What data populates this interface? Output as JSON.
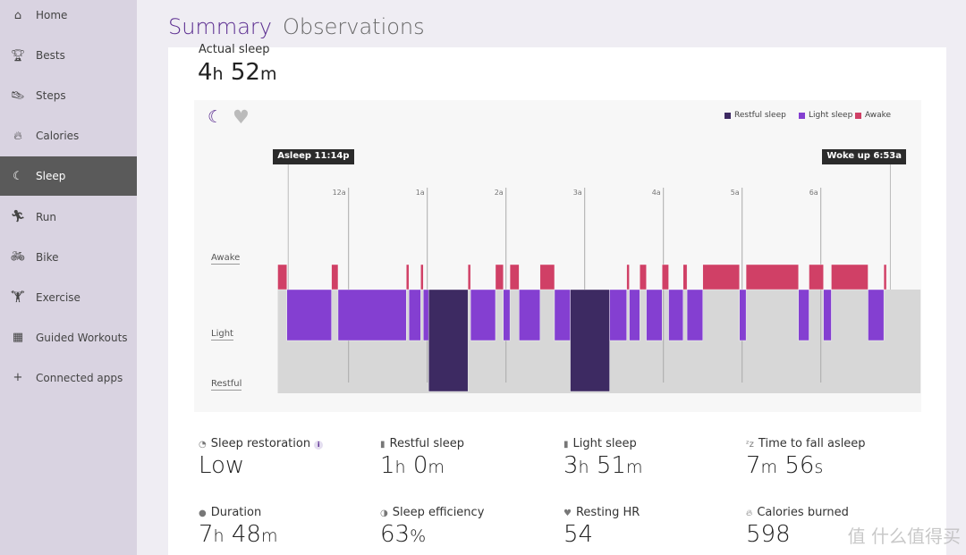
{
  "sidebar": {
    "items": [
      {
        "label": "Home",
        "icon": "home-icon",
        "glyph": "⌂"
      },
      {
        "label": "Bests",
        "icon": "trophy-icon",
        "glyph": "🏆︎"
      },
      {
        "label": "Steps",
        "icon": "shoe-icon",
        "glyph": "👟︎"
      },
      {
        "label": "Calories",
        "icon": "flame-icon",
        "glyph": "🔥︎"
      },
      {
        "label": "Sleep",
        "icon": "moon-icon",
        "glyph": "☾",
        "active": true
      },
      {
        "label": "Run",
        "icon": "runner-icon",
        "glyph": "🏃︎"
      },
      {
        "label": "Bike",
        "icon": "bike-icon",
        "glyph": "🚲︎"
      },
      {
        "label": "Exercise",
        "icon": "dumbbell-icon",
        "glyph": "🏋︎"
      },
      {
        "label": "Guided Workouts",
        "icon": "guided-workout-icon",
        "glyph": "▦"
      },
      {
        "label": "Connected apps",
        "icon": "plus-icon",
        "glyph": "+"
      }
    ]
  },
  "header": {
    "tab_summary": "Summary",
    "tab_observations": "Observations"
  },
  "actual_sleep": {
    "label": "Actual sleep",
    "hours": "4",
    "h": "h",
    "minutes": "52",
    "m": "m"
  },
  "chart_data": {
    "type": "timeline",
    "x_range": [
      "23:06",
      "07:16"
    ],
    "x_ticks": [
      "12a",
      "1a",
      "2a",
      "3a",
      "4a",
      "5a",
      "6a"
    ],
    "rows": [
      "Awake",
      "Light",
      "Restful"
    ],
    "markers": {
      "asleep": {
        "label": "Asleep 11:14p",
        "time": "23:14"
      },
      "woke": {
        "label": "Woke up 6:53a",
        "time": "06:53"
      }
    },
    "legend": [
      {
        "name": "Restful sleep",
        "color": "#3d2a62"
      },
      {
        "name": "Light sleep",
        "color": "#843fd1"
      },
      {
        "name": "Awake",
        "color": "#d04066"
      }
    ],
    "segments": [
      [
        "awake",
        "23:06",
        "23:13"
      ],
      [
        "light",
        "23:13",
        "23:47"
      ],
      [
        "awake",
        "23:47",
        "23:52"
      ],
      [
        "light",
        "23:52",
        "00:44"
      ],
      [
        "awake",
        "00:44",
        "00:46"
      ],
      [
        "light",
        "00:46",
        "00:55"
      ],
      [
        "awake",
        "00:55",
        "00:57"
      ],
      [
        "light",
        "00:57",
        "01:01"
      ],
      [
        "restful",
        "01:01",
        "01:31"
      ],
      [
        "awake",
        "01:31",
        "01:33"
      ],
      [
        "light",
        "01:33",
        "01:52"
      ],
      [
        "awake",
        "01:52",
        "01:58"
      ],
      [
        "light",
        "01:58",
        "02:03"
      ],
      [
        "awake",
        "02:03",
        "02:10"
      ],
      [
        "light",
        "02:10",
        "02:26"
      ],
      [
        "awake",
        "02:26",
        "02:37"
      ],
      [
        "light",
        "02:37",
        "02:49"
      ],
      [
        "restful",
        "02:49",
        "03:19"
      ],
      [
        "light",
        "03:19",
        "03:32"
      ],
      [
        "awake",
        "03:32",
        "03:34"
      ],
      [
        "light",
        "03:34",
        "03:42"
      ],
      [
        "awake",
        "03:42",
        "03:47"
      ],
      [
        "light",
        "03:47",
        "03:59"
      ],
      [
        "awake",
        "03:59",
        "04:04"
      ],
      [
        "light",
        "04:04",
        "04:15"
      ],
      [
        "awake",
        "04:15",
        "04:18"
      ],
      [
        "light",
        "04:18",
        "04:30"
      ],
      [
        "awake",
        "04:30",
        "04:58"
      ],
      [
        "light",
        "04:58",
        "05:03"
      ],
      [
        "awake",
        "05:03",
        "05:43"
      ],
      [
        "light",
        "05:43",
        "05:51"
      ],
      [
        "awake",
        "05:51",
        "06:02"
      ],
      [
        "light",
        "06:02",
        "06:08"
      ],
      [
        "awake",
        "06:08",
        "06:36"
      ],
      [
        "light",
        "06:36",
        "06:48"
      ],
      [
        "awake",
        "06:48",
        "06:50"
      ]
    ]
  },
  "stats": [
    {
      "label": "Sleep restoration",
      "icon": "restoration-icon",
      "glyph": "◔",
      "info": "i",
      "value": "Low"
    },
    {
      "label": "Restful sleep",
      "icon": "bar-chart-icon",
      "glyph": "▮",
      "parts": [
        [
          "1",
          "h"
        ],
        [
          "0",
          "m"
        ]
      ]
    },
    {
      "label": "Light sleep",
      "icon": "bar-chart-icon",
      "glyph": "▮",
      "parts": [
        [
          "3",
          "h"
        ],
        [
          "51",
          "m"
        ]
      ]
    },
    {
      "label": "Time to fall asleep",
      "icon": "zzz-icon",
      "glyph": "ᶻz",
      "parts": [
        [
          "7",
          "m"
        ],
        [
          "56",
          "s"
        ]
      ]
    },
    {
      "label": "Duration",
      "icon": "stopwatch-icon",
      "glyph": "●",
      "parts": [
        [
          "7",
          "h"
        ],
        [
          "48",
          "m"
        ]
      ]
    },
    {
      "label": "Sleep efficiency",
      "icon": "efficiency-icon",
      "glyph": "◑",
      "parts": [
        [
          "63",
          "%"
        ]
      ]
    },
    {
      "label": "Resting HR",
      "icon": "heart-icon",
      "glyph": "♥",
      "value": "54"
    },
    {
      "label": "Calories burned",
      "icon": "flame-icon",
      "glyph": "🔥︎",
      "value": "598"
    }
  ],
  "watermark": "值 什么值得买"
}
